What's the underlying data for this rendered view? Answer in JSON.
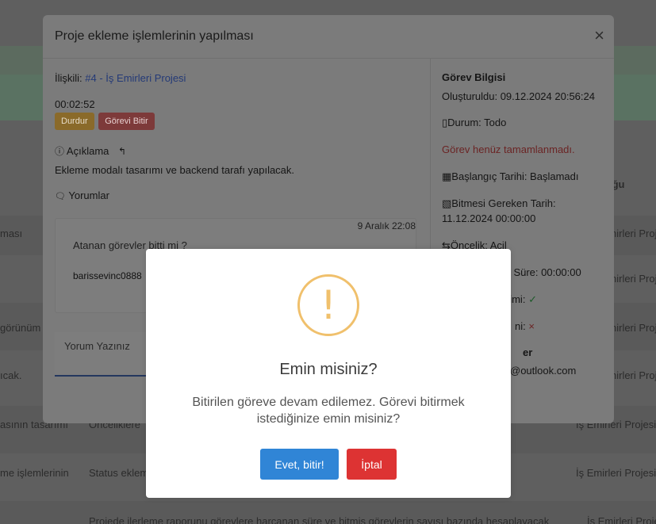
{
  "background": {
    "header_right": "ığu",
    "rows": [
      {
        "left": "ması",
        "right": "İş Emirleri Projesi"
      },
      {
        "left": "",
        "right": "İş Emirleri Projesi"
      },
      {
        "left": "görünüm",
        "right": "İş Emirleri Projesi"
      },
      {
        "left": "ıcak.",
        "right": "İş Emirleri Projesi"
      },
      {
        "left": "asının tasarımı",
        "mid": "Önceliklere",
        "right": "İş Emirleri Projesi"
      },
      {
        "left": "me işlemlerinin",
        "mid": "Status eklem",
        "right": "İş Emirleri Projesi"
      },
      {
        "mid": "Projede ilerleme raporunu görevlere harcanan süre ve bitmiş görevlerin sayısı bazında hesaplayacak",
        "right": "İş Emirleri Projesi"
      }
    ]
  },
  "modal": {
    "title": "Proje ekleme işlemlerinin yapılması",
    "close_icon": "×",
    "relation_label": "İlişkili:",
    "relation_link": "#4 - İş Emirleri Projesi",
    "timer": "00:02:52",
    "stop_button": "Durdur",
    "finish_button": "Görevi Bitir",
    "description_heading": "Açıklama",
    "description_text": "Ekleme modalı tasarımı ve backend tarafı yapılacak.",
    "comments_heading": "Yorumlar",
    "comment": {
      "date": "9 Aralık 22:08",
      "text": "Atanan görevler bitti mi ?",
      "author": "barissevinc0888"
    },
    "comment_placeholder": "Yorum Yazınız"
  },
  "task_info": {
    "heading": "Görev Bilgisi",
    "created": "Oluşturuldu: 09.12.2024 20:56:24",
    "status": "Durum: Todo",
    "not_completed": "Görev henüz tamamlanmadı.",
    "start_date": "Başlangıç Tarihi: Başlamadı",
    "due_label": "Bitmesi Gereken Tarih:",
    "due_value": "11.12.2024 00:00:00",
    "priority": "Öncelik: Acil",
    "duration_fragment": "m Süre: 00:00:00",
    "fragment1": "irimi:",
    "fragment2": "ni:",
    "fragment3": "er",
    "email_fragment": "@outlook.com"
  },
  "dialog": {
    "icon": "!",
    "title": "Emin misiniz?",
    "text": "Bitirilen göreve devam edilemez. Görevi bitirmek istediğinize emin misiniz?",
    "confirm": "Evet, bitir!",
    "cancel": "İptal"
  },
  "colors": {
    "confirm": "#3085d6",
    "cancel": "#dd3333",
    "warning": "#f0c06c"
  }
}
